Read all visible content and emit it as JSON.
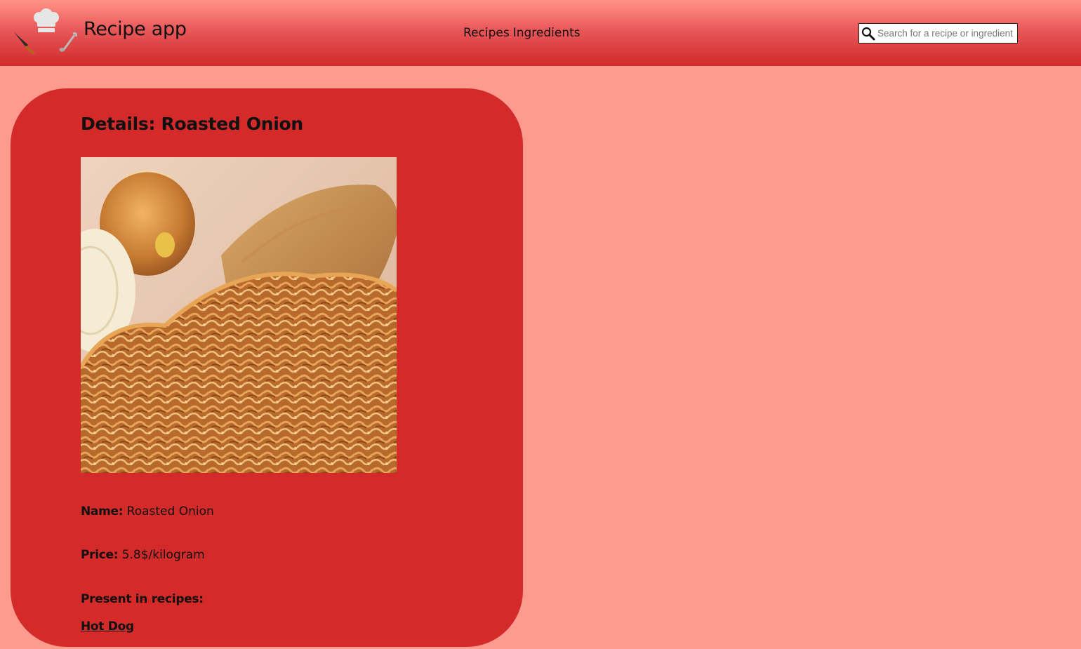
{
  "header": {
    "app_title": "Recipe app",
    "nav": [
      {
        "label": "Recipes"
      },
      {
        "label": "Ingredients"
      }
    ],
    "search": {
      "placeholder": "Search for a recipe or ingredient",
      "value": "",
      "icon": "search-icon"
    },
    "logo_icon": "chef-hat-knife-ladle-icon"
  },
  "details": {
    "title": "Details: Roasted Onion",
    "image_alt": "roasted onion photo",
    "name_label": "Name:",
    "name_value": "Roasted Onion",
    "price_label": "Price:",
    "price_value": "5.8$/kilogram",
    "recipes_label": "Present in recipes:",
    "recipes": [
      {
        "label": "Hot Dog"
      }
    ]
  },
  "colors": {
    "page_background": "#ff9b8e",
    "header_top": "#ff9486",
    "header_bottom": "#d22b2b",
    "card_background": "#d42a2a"
  }
}
